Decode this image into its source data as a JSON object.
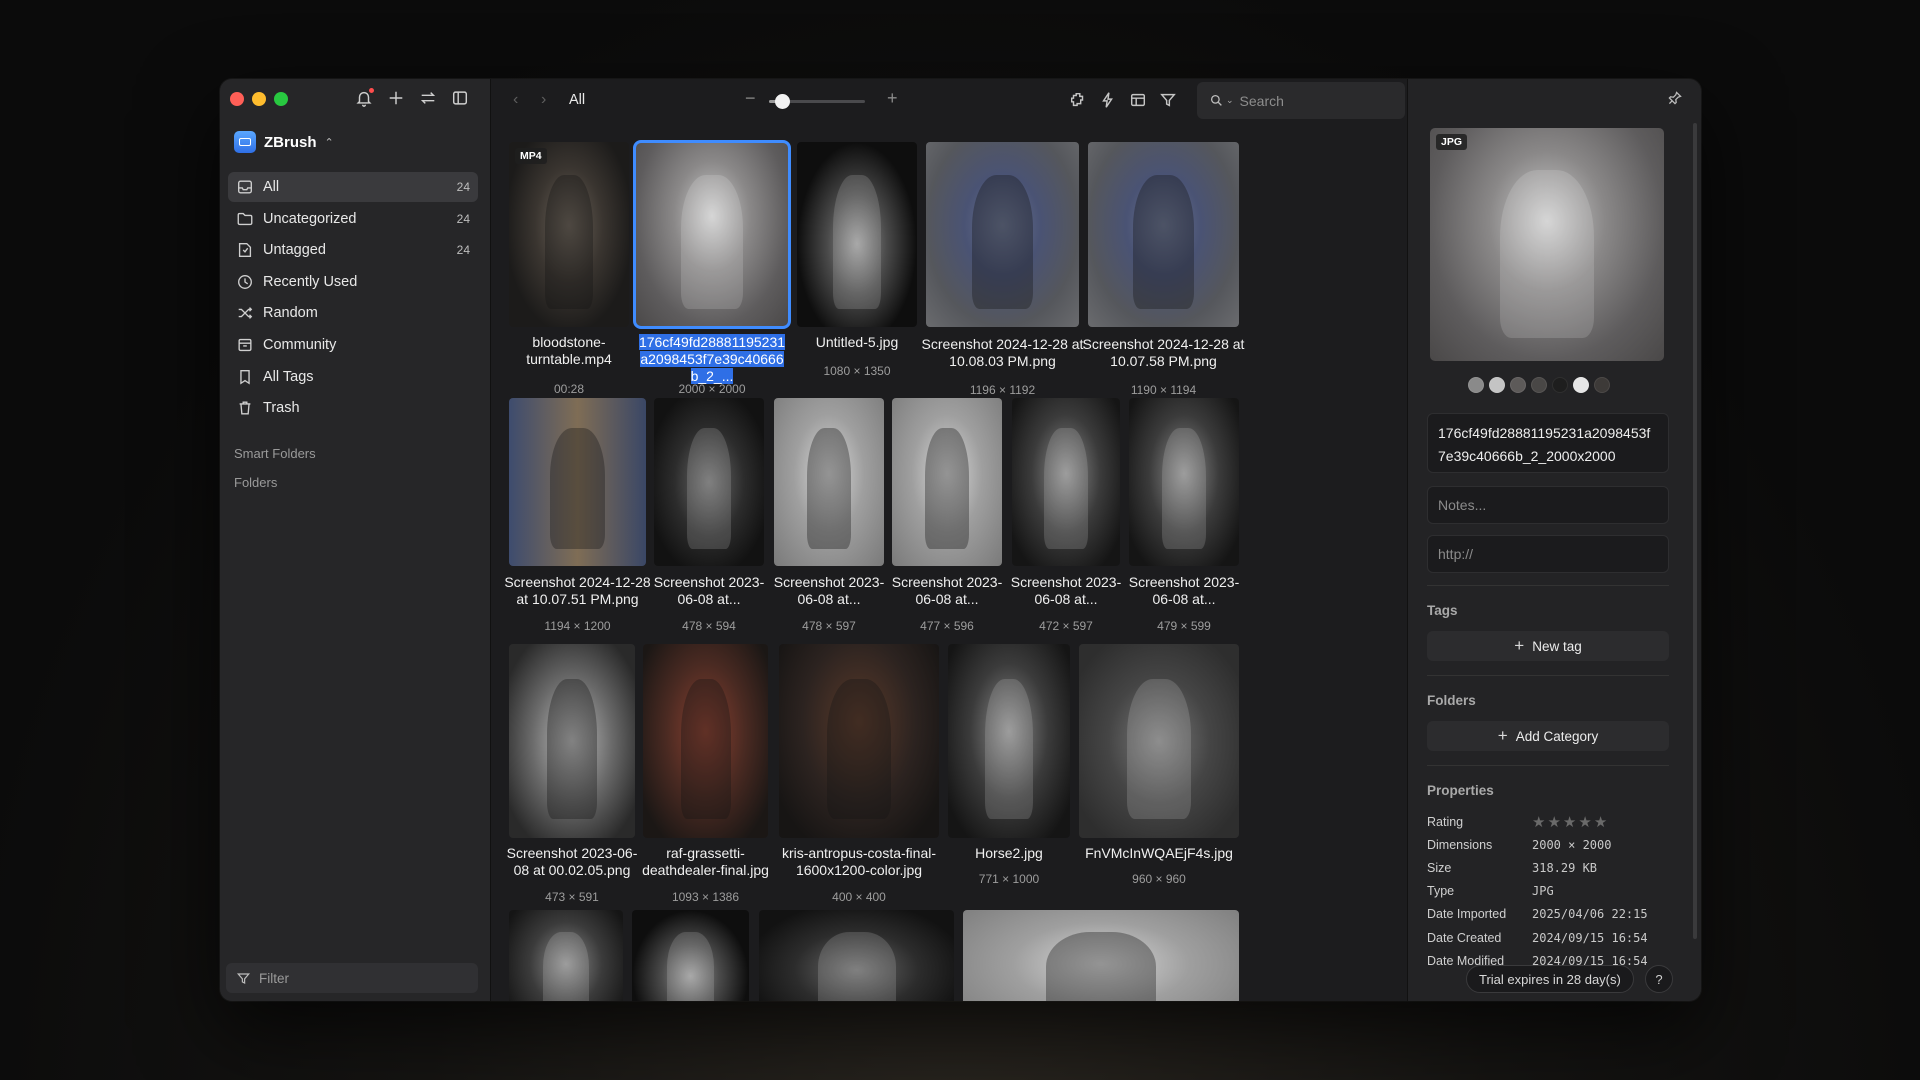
{
  "sidebar": {
    "library_name": "ZBrush",
    "items": [
      {
        "label": "All",
        "count": "24"
      },
      {
        "label": "Uncategorized",
        "count": "24"
      },
      {
        "label": "Untagged",
        "count": "24"
      },
      {
        "label": "Recently Used",
        "count": ""
      },
      {
        "label": "Random",
        "count": ""
      },
      {
        "label": "Community",
        "count": ""
      },
      {
        "label": "All Tags",
        "count": ""
      },
      {
        "label": "Trash",
        "count": ""
      }
    ],
    "smart_folders": "Smart Folders",
    "folders": "Folders",
    "filter_placeholder": "Filter"
  },
  "toolbar": {
    "breadcrumb": "All",
    "zoom_level": 0.14,
    "search_placeholder": "Search"
  },
  "files": [
    {
      "name": "bloodstone-turntable.mp4",
      "meta": "00:28",
      "badge": "MP4"
    },
    {
      "name": "176cf49fd28881195231a2098453f7e39c40666b_2_...",
      "meta": "2000 × 2000",
      "badge": ""
    },
    {
      "name": "Untitled-5.jpg",
      "meta": "1080 × 1350",
      "badge": ""
    },
    {
      "name": "Screenshot 2024-12-28 at 10.08.03 PM.png",
      "meta": "1196 × 1192",
      "badge": ""
    },
    {
      "name": "Screenshot 2024-12-28 at 10.07.58 PM.png",
      "meta": "1190 × 1194",
      "badge": ""
    },
    {
      "name": "Screenshot 2024-12-28 at 10.07.51 PM.png",
      "meta": "1194 × 1200",
      "badge": ""
    },
    {
      "name": "Screenshot 2023-06-08 at...",
      "meta": "478 × 594",
      "badge": ""
    },
    {
      "name": "Screenshot 2023-06-08 at...",
      "meta": "478 × 597",
      "badge": ""
    },
    {
      "name": "Screenshot 2023-06-08 at...",
      "meta": "477 × 596",
      "badge": ""
    },
    {
      "name": "Screenshot 2023-06-08 at...",
      "meta": "472 × 597",
      "badge": ""
    },
    {
      "name": "Screenshot 2023-06-08 at...",
      "meta": "479 × 599",
      "badge": ""
    },
    {
      "name": "Screenshot 2023-06-08 at 00.02.05.png",
      "meta": "473 × 591",
      "badge": ""
    },
    {
      "name": "raf-grassetti-deathdealer-final.jpg",
      "meta": "1093 × 1386",
      "badge": ""
    },
    {
      "name": "kris-antropus-costa-final-1600x1200-color.jpg",
      "meta": "400 × 400",
      "badge": ""
    },
    {
      "name": "Horse2.jpg",
      "meta": "771 × 1000",
      "badge": ""
    },
    {
      "name": "FnVMcInWQAEjF4s.jpg",
      "meta": "960 × 960",
      "badge": ""
    }
  ],
  "inspector": {
    "badge": "JPG",
    "filename": "176cf49fd28881195231a2098453f7e39c40666b_2_2000x2000",
    "notes_placeholder": "Notes...",
    "url_placeholder": "http://",
    "tags_label": "Tags",
    "new_tag": "New tag",
    "folders_label": "Folders",
    "add_category": "Add Category",
    "properties_label": "Properties",
    "swatches": [
      "#8a8a8a",
      "#c4c4c4",
      "#5d5a59",
      "#494746",
      "#1e1e1e",
      "#e6e6e6",
      "#3d3a38"
    ],
    "rating": 0,
    "properties": [
      {
        "key": "Rating",
        "value": ""
      },
      {
        "key": "Dimensions",
        "value": "2000 × 2000"
      },
      {
        "key": "Size",
        "value": "318.29 KB"
      },
      {
        "key": "Type",
        "value": "JPG"
      },
      {
        "key": "Date Imported",
        "value": "2025/04/06 22:15"
      },
      {
        "key": "Date Created",
        "value": "2024/09/15 16:54"
      },
      {
        "key": "Date Modified",
        "value": "2024/09/15 16:54"
      }
    ],
    "trial": "Trial expires in 28 day(s)",
    "help": "?"
  }
}
